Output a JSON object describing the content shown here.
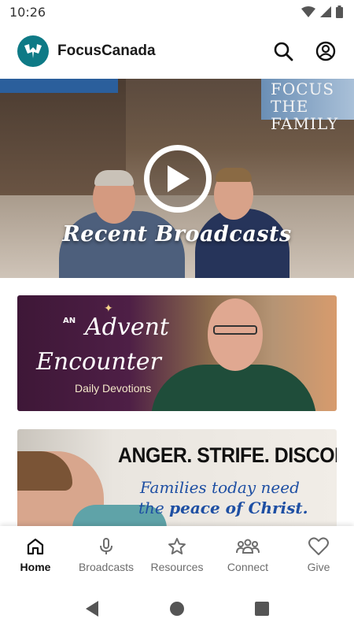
{
  "status_bar": {
    "time": "10:26"
  },
  "app_bar": {
    "title": "FocusCanada",
    "logo_icon": "focus-logo-icon",
    "search_icon": "search-icon",
    "profile_icon": "account-circle-icon"
  },
  "hero": {
    "caption": "Recent Broadcasts",
    "brand_sign": "FOCUS THE FAMILY",
    "play_icon": "play-icon"
  },
  "banners": {
    "advent": {
      "line1": "Advent",
      "small": "AN",
      "line2": "Encounter",
      "subtitle": "Daily Devotions"
    },
    "anger": {
      "headline": "ANGER. STRIFE. DISCORD.",
      "line2": "Families today need",
      "line3_prefix": "the",
      "line3_bold": "peace of Christ."
    }
  },
  "bottom_nav": {
    "items": [
      {
        "label": "Home",
        "icon": "home-icon",
        "active": true
      },
      {
        "label": "Broadcasts",
        "icon": "microphone-icon",
        "active": false
      },
      {
        "label": "Resources",
        "icon": "star-icon",
        "active": false
      },
      {
        "label": "Connect",
        "icon": "people-icon",
        "active": false
      },
      {
        "label": "Give",
        "icon": "heart-icon",
        "active": false
      }
    ]
  },
  "colors": {
    "brand": "#0e7a86",
    "active_nav": "#111111",
    "inactive_nav": "#6d6d6d",
    "banner_text_blue": "#1e4fa3"
  }
}
